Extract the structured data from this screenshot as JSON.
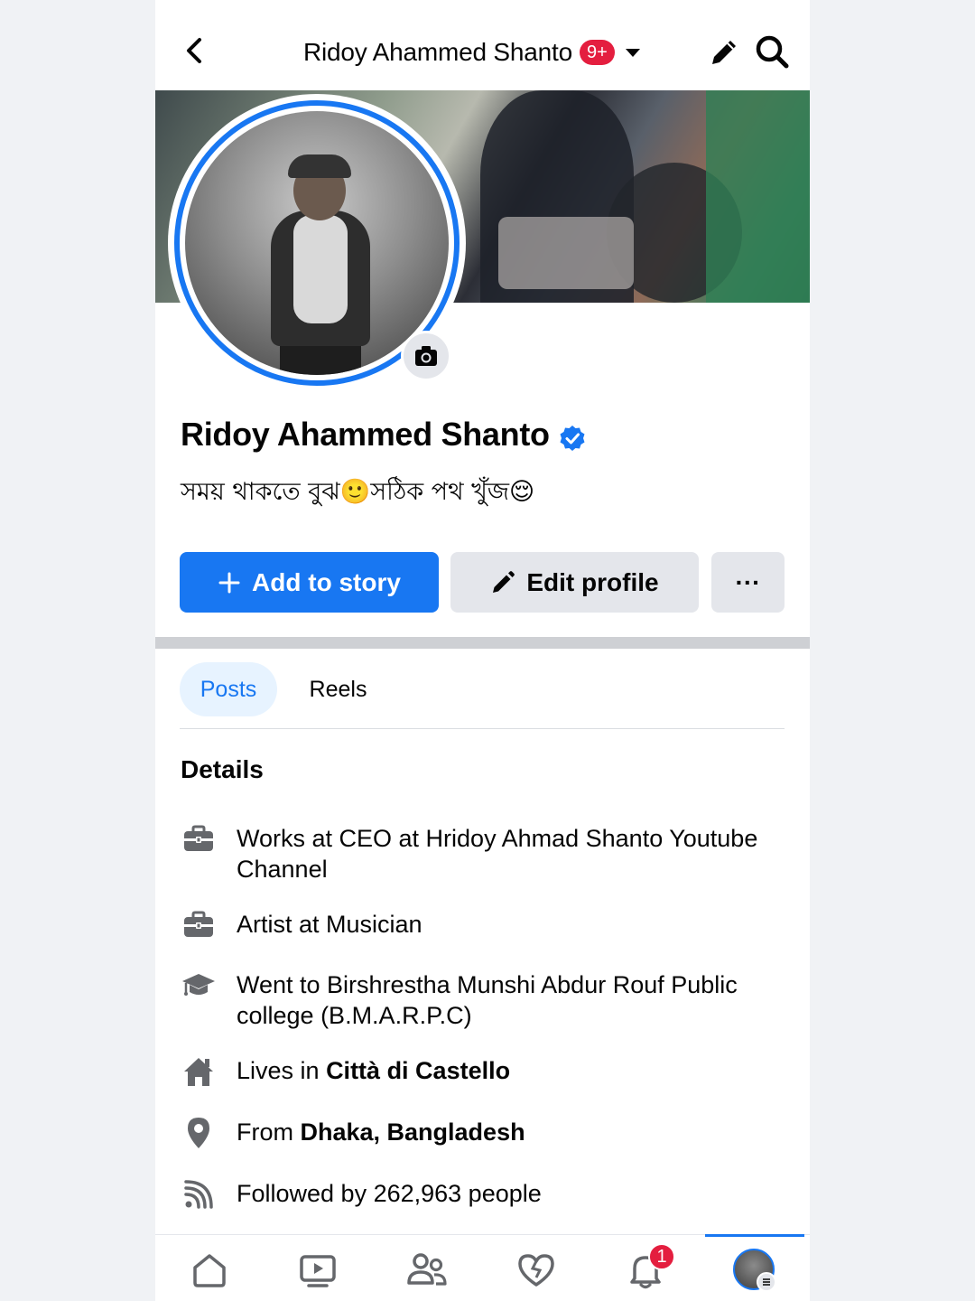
{
  "header": {
    "title": "Ridoy Ahammed Shanto",
    "notification_badge": "9+"
  },
  "profile": {
    "name": "Ridoy Ahammed Shanto",
    "verified": true,
    "bio": "সময় থাকতে বুঝ🙂সঠিক পথ খুঁজ😌"
  },
  "actions": {
    "add_story": "Add to story",
    "edit_profile": "Edit profile",
    "more": "···"
  },
  "tabs": [
    {
      "label": "Posts",
      "active": true
    },
    {
      "label": "Reels",
      "active": false
    }
  ],
  "details": {
    "title": "Details",
    "items": [
      {
        "icon": "briefcase-icon",
        "prefix": "Works at CEO at Hridoy Ahmad Shanto Youtube Channel",
        "bold": ""
      },
      {
        "icon": "briefcase-icon",
        "prefix": "Artist at Musician",
        "bold": ""
      },
      {
        "icon": "graduation-cap-icon",
        "prefix": "Went to Birshrestha Munshi Abdur Rouf Public college (B.M.A.R.P.C)",
        "bold": ""
      },
      {
        "icon": "home-icon",
        "prefix": "Lives in ",
        "bold": "Città di Castello"
      },
      {
        "icon": "location-pin-icon",
        "prefix": "From ",
        "bold": "Dhaka, Bangladesh"
      },
      {
        "icon": "rss-icon",
        "prefix": "Followed by 262,963 people",
        "bold": ""
      }
    ]
  },
  "bottom_nav": {
    "items": [
      "home-icon",
      "video-icon",
      "friends-icon",
      "dating-heart-icon",
      "notifications-bell-icon",
      "profile-avatar"
    ],
    "notification_count": "1",
    "active": "profile-avatar"
  },
  "colors": {
    "accent": "#1877f2",
    "badge": "#e41e3f",
    "button_gray": "#e4e6eb"
  }
}
